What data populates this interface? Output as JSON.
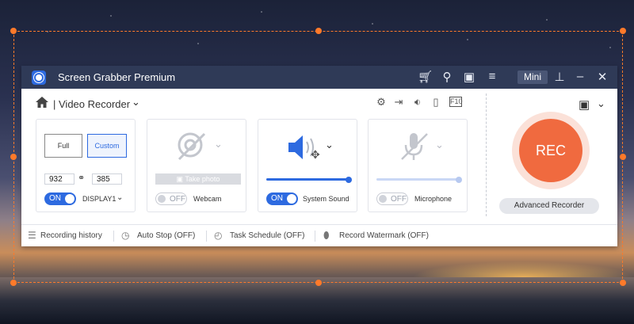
{
  "window": {
    "title": "Screen Grabber Premium",
    "mini_label": "Mini"
  },
  "toolbar": {
    "mode_label": "| Video Recorder"
  },
  "display_card": {
    "full_label": "Full",
    "custom_label": "Custom",
    "width_value": "932",
    "height_value": "385",
    "toggle_label": "ON",
    "display_label": "DISPLAY1"
  },
  "webcam_card": {
    "take_photo_label": "Take photo",
    "toggle_label": "OFF",
    "label": "Webcam"
  },
  "system_sound_card": {
    "toggle_label": "ON",
    "label": "System Sound",
    "volume_level": 1.0
  },
  "microphone_card": {
    "toggle_label": "OFF",
    "label": "Microphone",
    "volume_level": 1.0
  },
  "record_panel": {
    "rec_label": "REC",
    "advanced_label": "Advanced Recorder"
  },
  "footer": {
    "recording_history": "Recording history",
    "auto_stop": "Auto Stop (OFF)",
    "task_schedule": "Task Schedule (OFF)",
    "record_watermark": "Record Watermark (OFF)"
  },
  "colors": {
    "accent": "#2d6ae0",
    "rec": "#f06a3f",
    "titlebar": "#2f3a57",
    "selection": "#ff7a2a"
  }
}
